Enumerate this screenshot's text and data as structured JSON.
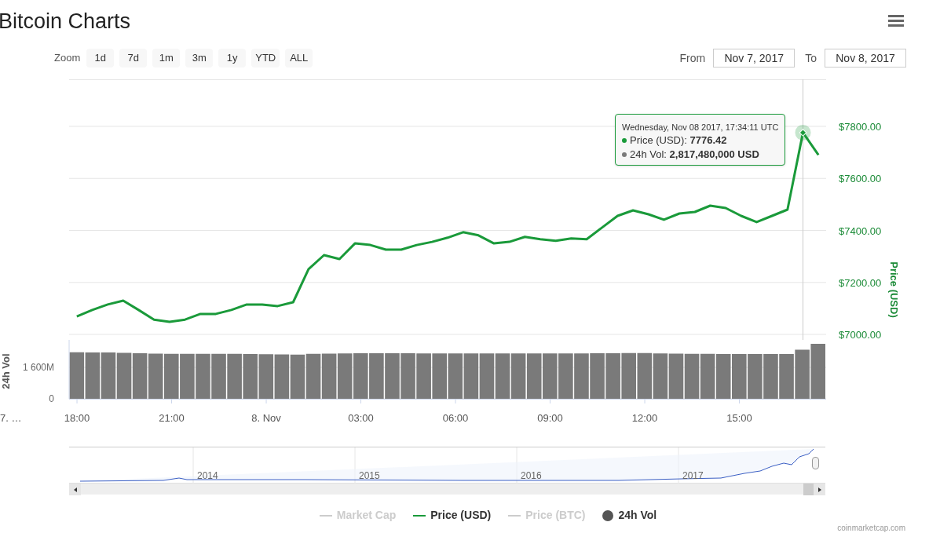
{
  "title": "Bitcoin Charts",
  "range_selector": {
    "label": "Zoom",
    "buttons": [
      {
        "label": "1d",
        "selected": false
      },
      {
        "label": "7d",
        "selected": false
      },
      {
        "label": "1m",
        "selected": false
      },
      {
        "label": "3m",
        "selected": false
      },
      {
        "label": "1y",
        "selected": false
      },
      {
        "label": "YTD",
        "selected": false
      },
      {
        "label": "ALL",
        "selected": false
      }
    ],
    "from_label": "From",
    "from_value": "Nov 7, 2017",
    "to_label": "To",
    "to_value": "Nov 8, 2017"
  },
  "price_chart": {
    "chart_data": {
      "type": "line",
      "ylabel": "Price (USD)",
      "categories": [
        null,
        null,
        null,
        null,
        null,
        null,
        null,
        null,
        null,
        null,
        null,
        null,
        null,
        null,
        null,
        null,
        null,
        null,
        null,
        null,
        null,
        null,
        null,
        null,
        null,
        null,
        null,
        null,
        null,
        null,
        null,
        null,
        null,
        null,
        null,
        null,
        null,
        null,
        null,
        null,
        null,
        null,
        null,
        null,
        null,
        null,
        null,
        null,
        null
      ],
      "series": [
        {
          "color": "#1a9a3a",
          "values": [
            7069,
            7094,
            7115,
            7130,
            7094,
            7057,
            7048,
            7057,
            7079,
            7079,
            7094,
            7115,
            7115,
            7109,
            7124,
            7251,
            7305,
            7290,
            7350,
            7344,
            7326,
            7326,
            7344,
            7356,
            7372,
            7393,
            7381,
            7350,
            7356,
            7375,
            7366,
            7360,
            7369,
            7366,
            7411,
            7456,
            7477,
            7462,
            7441,
            7465,
            7471,
            7495,
            7486,
            7456,
            7432,
            7456,
            7480,
            7776,
            7690
          ]
        }
      ],
      "ylim": [
        6979,
        7981
      ],
      "grid": true,
      "yticks": [
        {
          "value": 7000,
          "label": "$7000.00"
        },
        {
          "value": 7200,
          "label": "$7200.00"
        },
        {
          "value": 7400,
          "label": "$7400.00"
        },
        {
          "value": 7600,
          "label": "$7600.00"
        },
        {
          "value": 7800,
          "label": "$7800.00"
        }
      ]
    },
    "tooltip": {
      "header": "Wednesday, Nov 08 2017, 17:34:11 UTC",
      "rows": [
        {
          "label": "Price (USD): ",
          "value": "7776.42",
          "color": "#1a9a3a"
        },
        {
          "label": "24h Vol: ",
          "value": "2,817,480,000 USD",
          "color": "#7a7a7a"
        }
      ]
    }
  },
  "volume_chart": {
    "chart_data": {
      "type": "bar",
      "ylabel": "24h Vol",
      "categories": [
        "18:00",
        null,
        null,
        null,
        null,
        null,
        "21:00",
        null,
        null,
        null,
        null,
        null,
        "8. Nov",
        null,
        null,
        null,
        null,
        null,
        "03:00",
        null,
        null,
        null,
        null,
        null,
        "06:00",
        null,
        null,
        null,
        null,
        null,
        "09:00",
        null,
        null,
        null,
        null,
        null,
        "12:00",
        null,
        null,
        null,
        null,
        null,
        "15:00",
        null,
        null,
        null,
        null,
        null
      ],
      "series": [
        {
          "color": "#7a7a7a",
          "values": [
            2370,
            2360,
            2360,
            2340,
            2320,
            2300,
            2290,
            2290,
            2290,
            2290,
            2290,
            2280,
            2270,
            2260,
            2250,
            2290,
            2300,
            2310,
            2320,
            2320,
            2320,
            2320,
            2310,
            2310,
            2310,
            2310,
            2310,
            2310,
            2310,
            2310,
            2310,
            2310,
            2310,
            2320,
            2320,
            2330,
            2330,
            2310,
            2300,
            2290,
            2290,
            2280,
            2280,
            2280,
            2280,
            2280,
            2500,
            2800
          ]
        }
      ],
      "ylim": [
        0,
        3000
      ],
      "grid": true,
      "yticks": [
        {
          "value": 0,
          "label": "0"
        },
        {
          "value": 1600,
          "label": "1 600M"
        }
      ]
    },
    "cut_label": "7. …"
  },
  "navigator": {
    "years": [
      "2014",
      "2015",
      "2016",
      "2017"
    ]
  },
  "legend": [
    {
      "label": "Market Cap",
      "kind": "line",
      "color": "#cccccc",
      "enabled": false
    },
    {
      "label": "Price (USD)",
      "kind": "line",
      "color": "#1a9a3a",
      "enabled": true
    },
    {
      "label": "Price (BTC)",
      "kind": "line",
      "color": "#cccccc",
      "enabled": false
    },
    {
      "label": "24h Vol",
      "kind": "dot",
      "color": "#555555",
      "enabled": true
    }
  ],
  "credits": "coinmarketcap.com"
}
